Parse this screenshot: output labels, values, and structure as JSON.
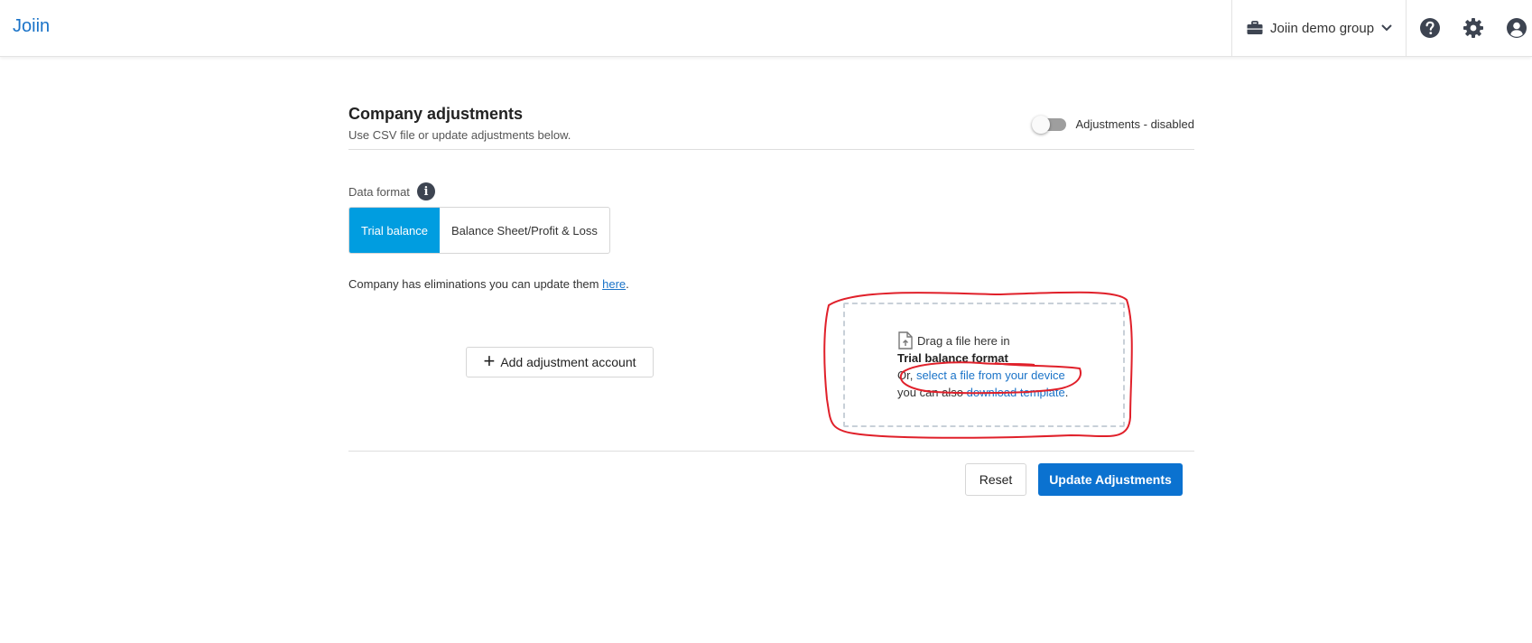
{
  "header": {
    "brand": "Joiin",
    "group_name": "Joiin demo group",
    "icons": [
      "briefcase-icon",
      "chevron-down-icon",
      "help-icon",
      "gear-icon",
      "account-icon"
    ]
  },
  "section": {
    "title": "Company adjustments",
    "subtitle": "Use CSV file or update adjustments below.",
    "toggle_label": "Adjustments - disabled",
    "toggle_on": false
  },
  "data_format": {
    "label": "Data format",
    "options": [
      "Trial balance",
      "Balance Sheet/Profit & Loss"
    ],
    "selected": "Trial balance"
  },
  "eliminations": {
    "text": "Company has eliminations you can update them ",
    "link": "here",
    "suffix": "."
  },
  "add_button": "Add adjustment account",
  "dropzone": {
    "line1": "Drag a file here in",
    "format": "Trial balance format",
    "or_prefix": "Or, ",
    "select_link": "select a file from your device",
    "also_prefix": "you can also ",
    "template_link": "download template",
    "template_suffix": "."
  },
  "footer": {
    "reset": "Reset",
    "update": "Update Adjustments"
  },
  "colors": {
    "brand": "#1a73c8",
    "segment_active": "#009de0",
    "primary_button": "#0b72d0",
    "annotation": "#e0202a"
  }
}
